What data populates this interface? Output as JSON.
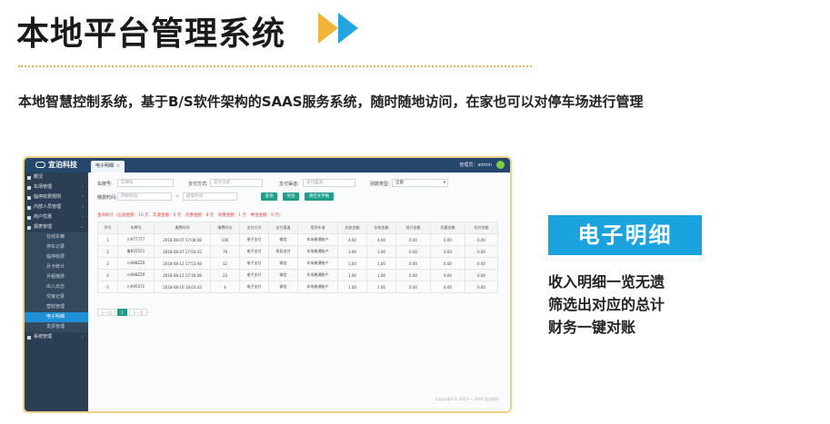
{
  "heading": "本地平台管理系统",
  "subtitle": "本地智慧控制系统，基于B/S软件架构的SAAS服务系统，随时随地访问，在家也可以对停车场进行管理",
  "colors": {
    "accent_yellow": "#f0b437",
    "accent_blue": "#23a6e0",
    "badge": "#1ba3e0",
    "topbar": "#25476b",
    "sidebar": "#2c3e53",
    "button": "#1f9e8a"
  },
  "app": {
    "logo": "宜泊科技",
    "tab": "电子明细",
    "user": "管理员：admin",
    "sidebar": {
      "items": [
        {
          "label": "概况",
          "icon": "grid-icon"
        },
        {
          "label": "车场管理",
          "icon": "parking-icon"
        },
        {
          "label": "临停收费规则",
          "icon": "rule-icon"
        },
        {
          "label": "内部人员管理",
          "icon": "person-icon"
        },
        {
          "label": "商户优惠",
          "icon": "shop-icon"
        },
        {
          "label": "报表管理",
          "icon": "report-icon"
        }
      ],
      "subitems": [
        "在线车辆",
        "停车记录",
        "临停收费",
        "月卡统计",
        "月租缴费",
        "出入日志",
        "交接记录",
        "营收管理",
        "电子明细",
        "发票管理"
      ],
      "active_sub": "电子明细",
      "last_item": "系统管理"
    },
    "filters": {
      "plate_label": "车牌号:",
      "plate_placeholder": "车牌号",
      "paytype_label": "支付方式:",
      "paytype_placeholder": "支付方式",
      "channel_label": "支付渠道:",
      "channel_placeholder": "支付渠道",
      "lot_label": "别数类型:",
      "lot_value": "全部",
      "time_label": "缴费时间:",
      "start_placeholder": "开始时间",
      "sep": "~",
      "end_placeholder": "结束时间",
      "btn_search": "查询",
      "btn_export": "导出",
      "btn_reset": "清空文字框"
    },
    "summary": "查询统计（应收金额：16 元　实收金额：6 元　优惠金额：8 元　优惠金额：1 元　押金金额：0 元）",
    "table": {
      "headers": [
        "序号",
        "车牌号",
        "缴费时间",
        "缴费时长",
        "支付方式",
        "支付渠道",
        "用到车道",
        "应收金额",
        "实收金额",
        "现付金额",
        "优惠金额",
        "实付金额"
      ],
      "rows": [
        [
          "1",
          "川A77777",
          "2018-08-07 17:08:08",
          "106",
          "电子支付",
          "微信",
          "车场普通账户",
          "4.00",
          "4.00",
          "0.00",
          "0.00",
          "0.00"
        ],
        [
          "2",
          "鲁B55551",
          "2018-08-07 17:03:43",
          "79",
          "电子支付",
          "帮扣支付",
          "车场普通账户",
          "3.00",
          "3.00",
          "0.00",
          "0.00",
          "0.00"
        ],
        [
          "3",
          "川A88ZZ0",
          "2018-08-12 17:53:08",
          "12",
          "电子支付",
          "微信",
          "车场普通账户",
          "1.00",
          "1.00",
          "0.00",
          "0.00",
          "0.00"
        ],
        [
          "4",
          "川A88ZZ0",
          "2018-08-12 17:16:08",
          "23",
          "电子支付",
          "微信",
          "车场普通账户",
          "1.00",
          "1.00",
          "0.00",
          "0.00",
          "0.00"
        ],
        [
          "5",
          "川A95S71",
          "2018-08-10 18:03:43",
          "4",
          "电子支付",
          "微信",
          "车场普通账户",
          "1.00",
          "1.00",
          "0.00",
          "0.00",
          "0.00"
        ]
      ]
    },
    "pager": {
      "prev": "上一页",
      "page": "1",
      "next": "下一页"
    },
    "copyright": "Copyright © 2013 — 2018 宜泊科技"
  },
  "feature": {
    "title": "电子明细",
    "lines": [
      "收入明细一览无遗",
      "筛选出对应的总计",
      "财务一键对账"
    ]
  }
}
